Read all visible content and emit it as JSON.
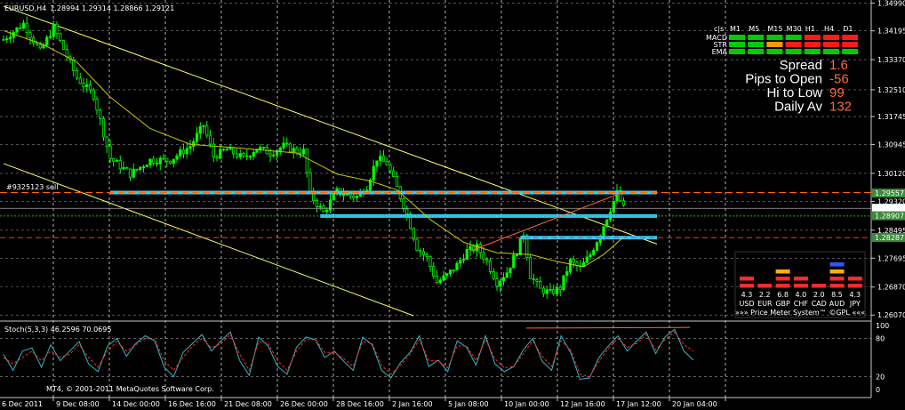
{
  "header": {
    "symbol_timeframe": "EURUSD,H4",
    "ohlc": "1.28994 1.29314 1.28866 1.29121"
  },
  "trade_label": "#9325123 sell",
  "copyright": "MT4, © 2001-2011 MetaQuotes Software Corp.",
  "stoch": {
    "title": "Stoch(5,3,3) 46.2596 70.0695",
    "levels": [
      "100",
      "80",
      "20",
      "0"
    ]
  },
  "signal_panel": {
    "corner": "c|s",
    "timeframes": [
      "M1",
      "M5",
      "M15",
      "M30",
      "H1",
      "H4",
      "D1"
    ],
    "rows": [
      {
        "name": "MACD",
        "colors": [
          "#00cc00",
          "#00cc00",
          "#00cc00",
          "#00cc00",
          "#ff1a1a",
          "#ff1a1a",
          "#ff1a1a"
        ]
      },
      {
        "name": "STR",
        "colors": [
          "#00cc00",
          "#00cc00",
          "#ff9900",
          "#ff1a1a",
          "#ff1a1a",
          "#ff1a1a",
          "#ff1a1a"
        ]
      },
      {
        "name": "EMA",
        "colors": [
          "#00cc00",
          "#00cc00",
          "#00cc00",
          "#00cc00",
          "#00cc00",
          "#00cc00",
          "#00cc00"
        ]
      }
    ]
  },
  "info": [
    {
      "label": "Spread",
      "value": "1.6"
    },
    {
      "label": "Pips to Open",
      "value": "-56"
    },
    {
      "label": "Hi to Low",
      "value": "99"
    },
    {
      "label": "Daily Av",
      "value": "132"
    }
  ],
  "price_meter": {
    "values": [
      "4.3",
      "2.2",
      "6.8",
      "4.0",
      "2.0",
      "8.5",
      "4.3"
    ],
    "currencies": [
      "USD",
      "EUR",
      "GBP",
      "CHF",
      "CAD",
      "AUD",
      "JPY"
    ],
    "footer": "»»» Price Meter System™ ©GPL «««"
  },
  "price_tags": [
    {
      "value": "1.29557",
      "color": "#3a8a3a",
      "text_color": "#ffffff"
    },
    {
      "value": "1.29121",
      "color": "#ffffff",
      "text_color": "#000000"
    },
    {
      "value": "1.28907",
      "color": "#3a8a3a",
      "text_color": "#ffffff"
    },
    {
      "value": "1.28287",
      "color": "#3a8a3a",
      "text_color": "#ffffff"
    }
  ],
  "colors": {
    "candle": "#00ff00",
    "ma": "#c8c800",
    "channel": "#ffff66",
    "level_line": "#33ccff",
    "trend_line": "#ff6633",
    "stoch_main": "#33b5c8",
    "stoch_signal": "#ff2a2a"
  },
  "chart_data": {
    "type": "candlestick",
    "title": "EURUSD,H4",
    "y_axis_ticks": [
      "1.34990",
      "1.34195",
      "1.33370",
      "1.32510",
      "1.31745",
      "1.30945",
      "1.30120",
      "1.29320",
      "1.28495",
      "1.27695",
      "1.26870",
      "1.26070"
    ],
    "x_axis_ticks": [
      "6 Dec 2011",
      "9 Dec 08:00",
      "14 Dec 00:00",
      "16 Dec 16:00",
      "21 Dec 08:00",
      "26 Dec 00:00",
      "28 Dec 16:00",
      "2 Jan 16:00",
      "5 Jan 08:00",
      "10 Jan 00:00",
      "12 Jan 16:00",
      "17 Jan 12:00",
      "20 Jan 04:00"
    ],
    "ylim": [
      1.2605,
      1.35
    ],
    "close_path": [
      [
        0,
        1.3395
      ],
      [
        6,
        1.344
      ],
      [
        11,
        1.336
      ],
      [
        15,
        1.343
      ],
      [
        22,
        1.3285
      ],
      [
        27,
        1.3235
      ],
      [
        32,
        1.3055
      ],
      [
        38,
        1.301
      ],
      [
        44,
        1.305
      ],
      [
        50,
        1.305
      ],
      [
        56,
        1.309
      ],
      [
        60,
        1.315
      ],
      [
        63,
        1.306
      ],
      [
        67,
        1.308
      ],
      [
        72,
        1.3055
      ],
      [
        76,
        1.3085
      ],
      [
        80,
        1.307
      ],
      [
        84,
        1.309
      ],
      [
        88,
        1.3075
      ],
      [
        90,
        1.3075
      ],
      [
        92,
        1.295
      ],
      [
        96,
        1.29
      ],
      [
        100,
        1.296
      ],
      [
        103,
        1.295
      ],
      [
        106,
        1.2945
      ],
      [
        109,
        1.2975
      ],
      [
        112,
        1.3055
      ],
      [
        115,
        1.304
      ],
      [
        118,
        1.297
      ],
      [
        121,
        1.2895
      ],
      [
        124,
        1.28
      ],
      [
        127,
        1.277
      ],
      [
        130,
        1.27
      ],
      [
        133,
        1.272
      ],
      [
        136,
        1.275
      ],
      [
        139,
        1.279
      ],
      [
        142,
        1.28
      ],
      [
        145,
        1.276
      ],
      [
        148,
        1.27
      ],
      [
        151,
        1.273
      ],
      [
        154,
        1.279
      ],
      [
        156,
        1.284
      ],
      [
        158,
        1.272
      ],
      [
        161,
        1.268
      ],
      [
        164,
        1.267
      ],
      [
        167,
        1.2685
      ],
      [
        170,
        1.276
      ],
      [
        173,
        1.274
      ],
      [
        176,
        1.278
      ],
      [
        179,
        1.284
      ],
      [
        182,
        1.291
      ],
      [
        184,
        1.2955
      ],
      [
        186,
        1.2912
      ]
    ],
    "ma_path": [
      [
        0,
        1.342
      ],
      [
        12,
        1.338
      ],
      [
        22,
        1.333
      ],
      [
        32,
        1.323
      ],
      [
        44,
        1.314
      ],
      [
        56,
        1.3095
      ],
      [
        70,
        1.3085
      ],
      [
        88,
        1.307
      ],
      [
        100,
        1.301
      ],
      [
        110,
        1.299
      ],
      [
        118,
        1.2965
      ],
      [
        128,
        1.288
      ],
      [
        138,
        1.2815
      ],
      [
        148,
        1.2785
      ],
      [
        158,
        1.278
      ],
      [
        166,
        1.276
      ],
      [
        174,
        1.2745
      ],
      [
        180,
        1.278
      ],
      [
        186,
        1.283
      ]
    ],
    "channel_upper": [
      [
        0,
        1.349
      ],
      [
        196,
        1.281
      ]
    ],
    "channel_lower": [
      [
        0,
        1.304
      ],
      [
        123,
        1.2605
      ]
    ],
    "resistance_level": {
      "value": 1.2957,
      "from": 32,
      "to": 196
    },
    "mid_level": {
      "value": 1.289,
      "from": 95,
      "to": 196
    },
    "support_level": {
      "value": 1.2828,
      "from": 155,
      "to": 196
    },
    "trend_line": [
      [
        140,
        1.279
      ],
      [
        185,
        1.2955
      ]
    ],
    "stochastic": {
      "main": [
        55,
        30,
        60,
        65,
        35,
        70,
        45,
        60,
        75,
        40,
        28,
        68,
        80,
        52,
        72,
        84,
        76,
        35,
        20,
        58,
        72,
        86,
        60,
        76,
        90,
        45,
        22,
        82,
        68,
        36,
        24,
        66,
        82,
        78,
        50,
        60,
        44,
        30,
        82,
        70,
        30,
        18,
        42,
        58,
        84,
        36,
        46,
        28,
        76,
        66,
        38,
        84,
        40,
        28,
        36,
        62,
        80,
        44,
        30,
        84,
        58,
        16,
        18,
        50,
        68,
        84,
        60,
        76,
        90,
        56,
        82,
        94,
        60,
        46
      ],
      "signal": [
        50,
        40,
        50,
        60,
        45,
        60,
        50,
        55,
        70,
        50,
        35,
        60,
        75,
        60,
        70,
        80,
        78,
        45,
        30,
        50,
        68,
        80,
        65,
        72,
        86,
        55,
        30,
        75,
        72,
        45,
        30,
        60,
        78,
        78,
        58,
        58,
        48,
        36,
        75,
        72,
        38,
        24,
        38,
        55,
        78,
        45,
        45,
        34,
        68,
        68,
        45,
        78,
        48,
        34,
        36,
        56,
        76,
        52,
        36,
        76,
        62,
        24,
        20,
        44,
        64,
        80,
        66,
        72,
        86,
        62,
        78,
        90,
        70,
        60
      ],
      "overbought_line": [
        [
          0.74,
          96
        ],
        [
          0.97,
          97
        ]
      ]
    }
  }
}
